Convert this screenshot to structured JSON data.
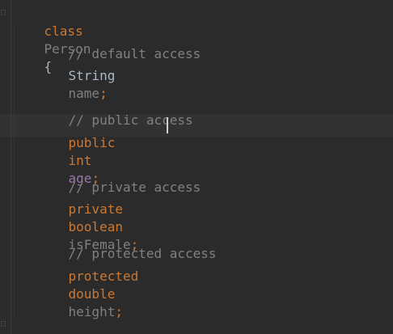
{
  "editor": {
    "class_decl": {
      "keyword": "class",
      "name": "Person",
      "open_brace": "{"
    },
    "blocks": [
      {
        "comment": "// default access",
        "modifier": "",
        "type": "String",
        "field": "name",
        "semicolon": ";"
      },
      {
        "comment": "// public access",
        "modifier": "public",
        "type": "int",
        "field": "age",
        "semicolon": ";"
      },
      {
        "comment": "// private access",
        "modifier": "private",
        "type": "boolean",
        "field": "isFemale",
        "semicolon": ";"
      },
      {
        "comment": "// protected access",
        "modifier": "protected",
        "type": "double",
        "field": "height",
        "semicolon": ";"
      }
    ],
    "close_brace": "}",
    "colors": {
      "background": "#2b2b2b",
      "keyword": "#cc7832",
      "comment": "#808080",
      "field": "#9876aa",
      "text": "#a9b7c6"
    },
    "icons": [
      "fold-icon"
    ]
  }
}
